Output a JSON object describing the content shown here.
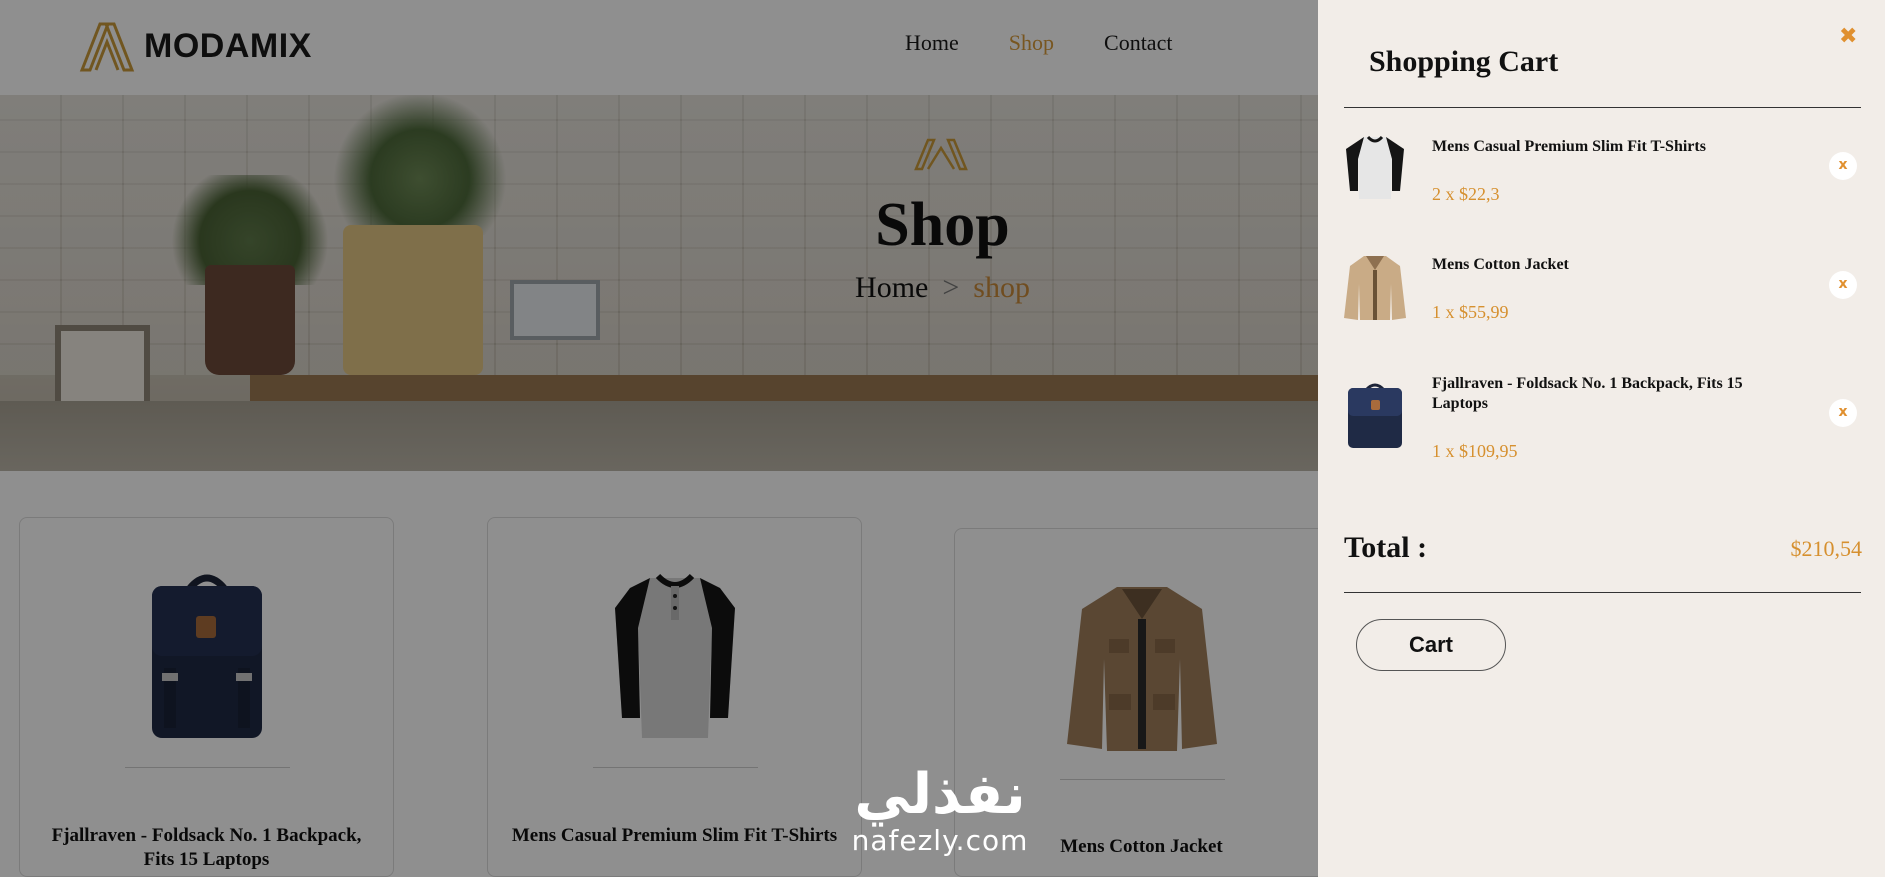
{
  "brand": {
    "name": "MODAMIX",
    "accent": "#d79a3a"
  },
  "nav": {
    "items": [
      {
        "label": "Home"
      },
      {
        "label": "Shop",
        "active": true
      },
      {
        "label": "Contact"
      }
    ]
  },
  "hero": {
    "title": "Shop",
    "breadcrumb": {
      "home": "Home",
      "separator": ">",
      "current": "shop"
    }
  },
  "products": [
    {
      "title": "Fjallraven - Foldsack No. 1 Backpack, Fits 15 Laptops",
      "image_icon": "backpack-icon"
    },
    {
      "title": "Mens Casual Premium Slim Fit T-Shirts",
      "image_icon": "tshirt-icon"
    },
    {
      "title": "Mens Cotton Jacket",
      "image_icon": "jacket-icon"
    }
  ],
  "watermark": {
    "arabic": "نفذلي",
    "latin": "nafezly.com"
  },
  "cart": {
    "title": "Shopping Cart",
    "close_icon": "close-icon",
    "items": [
      {
        "name": "Mens Casual Premium Slim Fit T-Shirts",
        "qty_price": "2 x $22,3",
        "remove": "x",
        "image_icon": "tshirt-icon"
      },
      {
        "name": "Mens Cotton Jacket",
        "qty_price": "1 x $55,99",
        "remove": "x",
        "image_icon": "jacket-icon"
      },
      {
        "name": "Fjallraven - Foldsack No. 1 Backpack, Fits 15 Laptops",
        "qty_price": "1 x $109,95",
        "remove": "x",
        "image_icon": "backpack-icon"
      }
    ],
    "total_label": "Total :",
    "total_value": "$210,54",
    "button_label": "Cart"
  }
}
